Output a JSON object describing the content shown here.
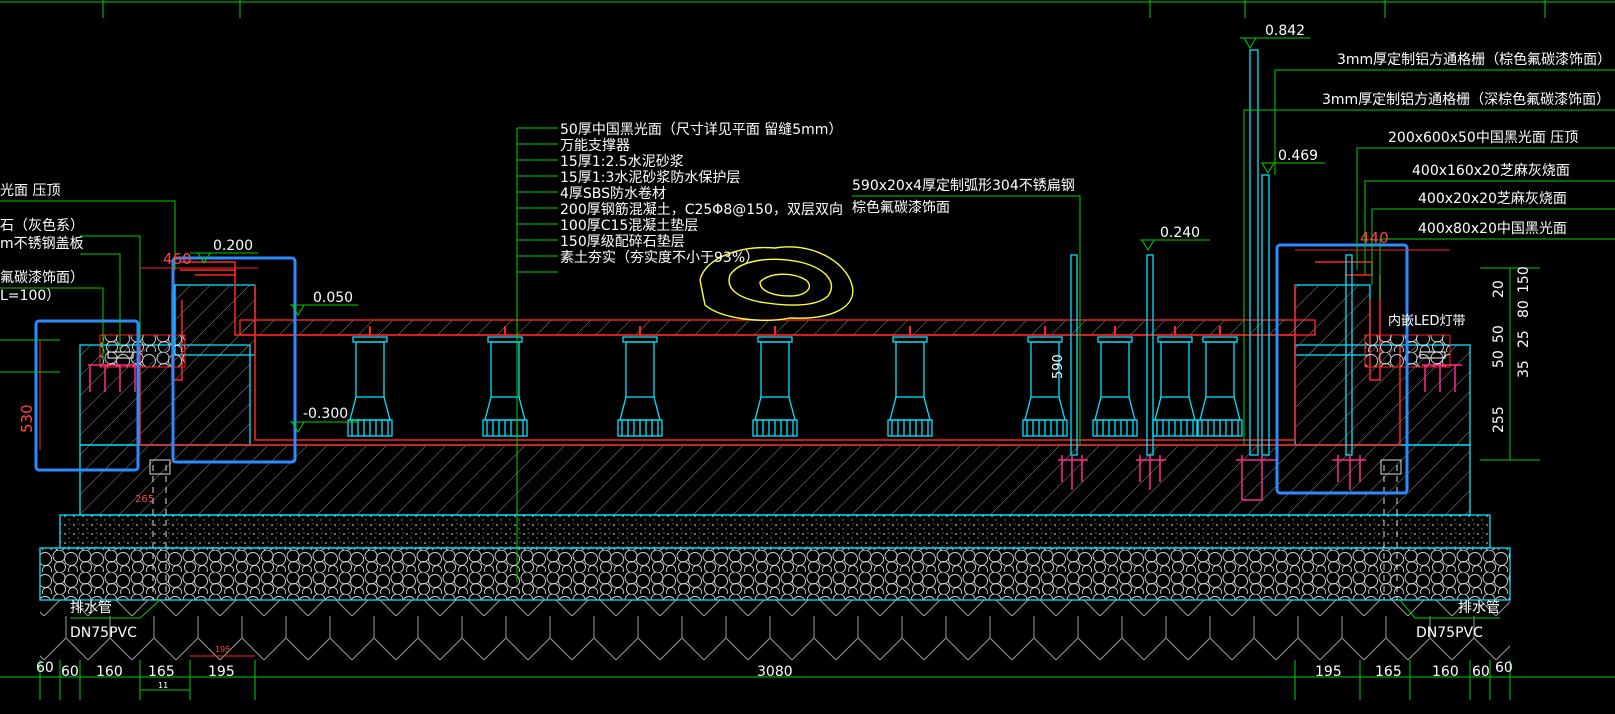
{
  "colors": {
    "background": "#000000",
    "dimension": "#00d000",
    "structure": "#00e5ff",
    "waterproof": "#ff2222",
    "rebar": "#ff2a8a",
    "highlight": "#2a8cff",
    "rock": "#ffff33"
  },
  "elevations": {
    "e0842": "0.842",
    "e0469": "0.469",
    "e0240": "0.240",
    "e0200": "0.200",
    "e0050": "0.050",
    "em0300": "-0.300"
  },
  "layers": [
    "50厚中国黑光面（尺寸详见平面 留缝5mm）",
    "万能支撑器",
    "15厚1:2.5水泥砂浆",
    "15厚1:3水泥砂浆防水保护层",
    "4厚SBS防水卷材",
    "200厚钢筋混凝土，C25Φ8@150，双层双向",
    "100厚C15混凝土垫层",
    "150厚级配碎石垫层",
    "素土夯实（夯实度不小于93%）"
  ],
  "left_labels": [
    "光面 压顶",
    "石（灰色系）",
    "m不锈钢盖板",
    "氟碳漆饰面）",
    "L=100）"
  ],
  "steel_label": {
    "line1": "590x20x4厚定制弧形304不锈扁钢",
    "line2": "棕色氟碳漆饰面"
  },
  "right_labels": [
    "3mm厚定制铝方通格栅（棕色氟碳漆饰面）",
    "3mm厚定制铝方通格栅（深棕色氟碳漆饰面）",
    "200x600x50中国黑光面 压顶",
    "400x160x20芝麻灰烧面",
    "400x20x20芝麻灰烧面",
    "400x80x20中国黑光面"
  ],
  "led_label": "内嵌LED灯带",
  "drain": {
    "pipe": "排水管",
    "size": "DN75PVC"
  },
  "red_dims": {
    "d460": "460",
    "d530": "530",
    "d440": "440",
    "d590": "590"
  },
  "small_dims": {
    "d265": "265"
  },
  "right_dims": [
    "150",
    "80",
    "20",
    "50",
    "25",
    "35",
    "50",
    "255"
  ],
  "bottom_dims": [
    "60",
    "60",
    "160",
    "165",
    "195",
    "3080",
    "195",
    "165",
    "160",
    "60",
    "60"
  ],
  "tiny_dims": {
    "d195": "195",
    "d11": "11"
  }
}
